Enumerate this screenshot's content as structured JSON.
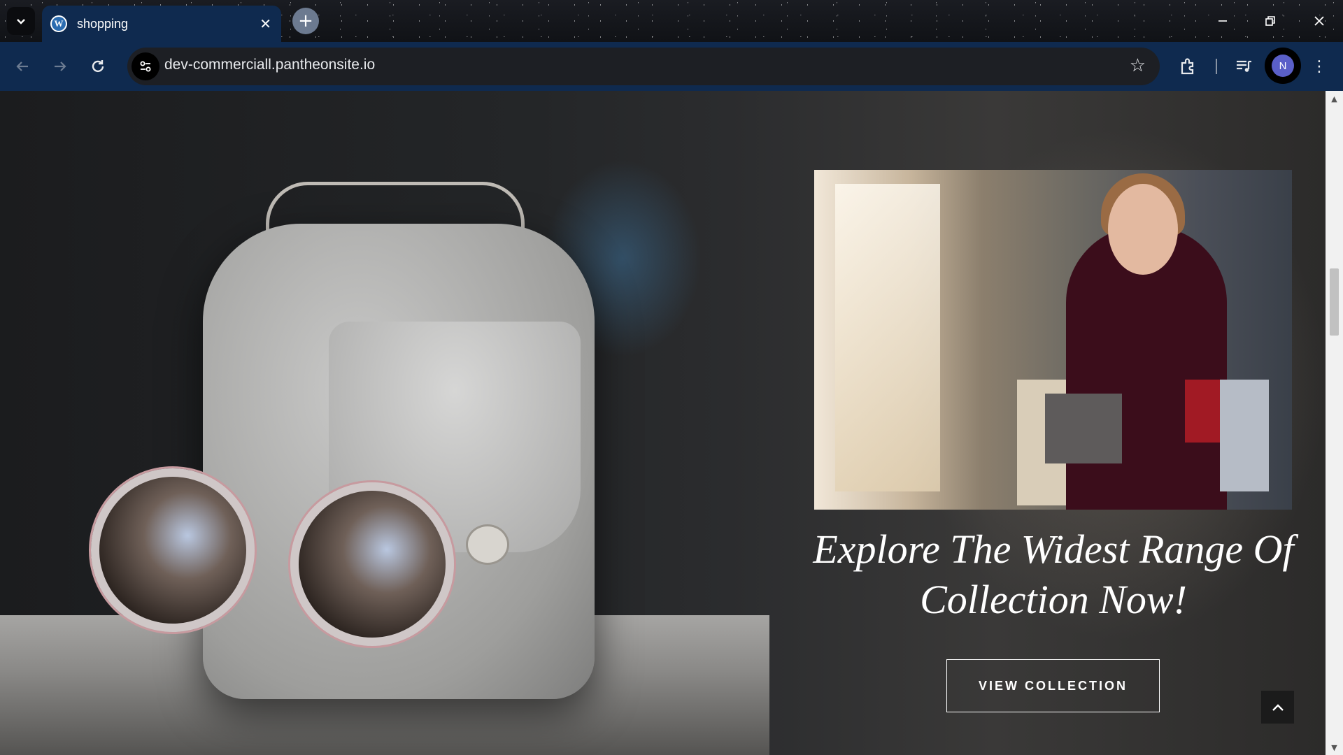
{
  "browser": {
    "tab": {
      "title": "shopping",
      "favicon": "wordpress-icon",
      "close": "✕"
    },
    "new_tab": "+",
    "window_controls": {
      "minimize": "—",
      "restore": "❐",
      "close": "✕"
    },
    "nav": {
      "back": "←",
      "forward": "→",
      "reload": "↻"
    },
    "address_bar": {
      "url": "dev-commerciall.pantheonsite.io",
      "site_info_icon": "tune-icon",
      "bookmark_icon": "star-icon"
    },
    "toolbar_icons": [
      "extensions-icon",
      "media-controls-icon",
      "profile-avatar",
      "menu-icon"
    ],
    "profile": {
      "initial": "N",
      "color": "#5a5fc8"
    },
    "menu": "⋮",
    "accent_color": "#0f2a4f"
  },
  "hero": {
    "headline_line1": "Explore The Widest Range Of",
    "headline_line2": "Collection Now!",
    "cta_label": "VIEW COLLECTION",
    "back_to_top_icon": "chevron-up-icon"
  },
  "scrollbar": {
    "up": "▲",
    "down": "▼"
  }
}
